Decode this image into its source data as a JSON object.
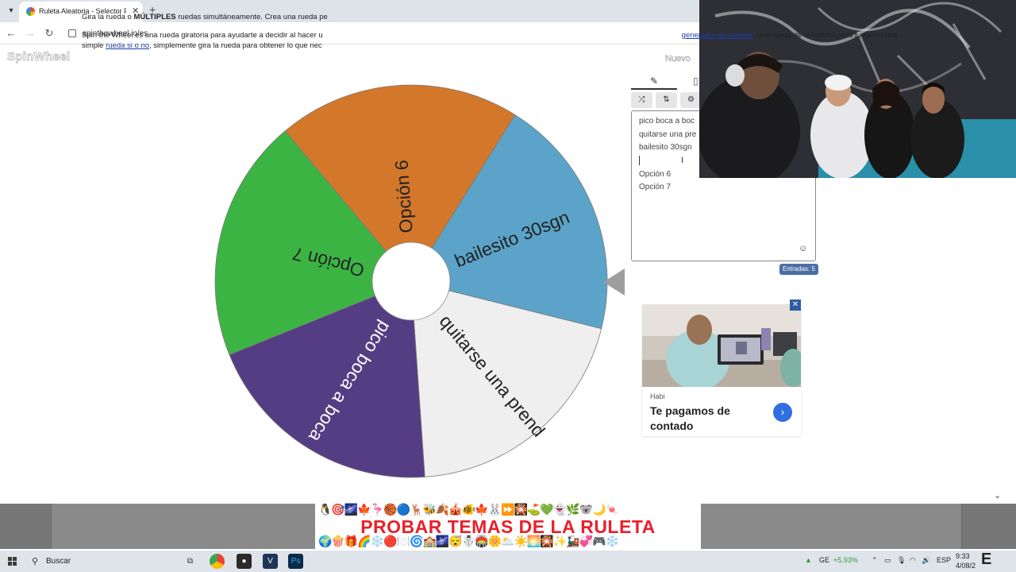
{
  "browser": {
    "tab_title": "Ruleta Aleatoria - Selector Perso",
    "url": "spinthewheel.io/es"
  },
  "page": {
    "logo": "SpinWheel",
    "new_button": "Nuevo"
  },
  "wheel": {
    "segments": [
      {
        "label": "bailesito 30sgn",
        "color": "#5ba3c8"
      },
      {
        "label": "quitarse una prend",
        "color": "#efefef"
      },
      {
        "label": "pico boca a boca",
        "color": "#553d84"
      },
      {
        "label": "Opción 7",
        "color": "#3cb444"
      },
      {
        "label": "Opción 6",
        "color": "#d3772b"
      }
    ],
    "text_colors": [
      "#222222",
      "#222222",
      "#ffffff",
      "#222222",
      "#222222"
    ],
    "hub_color": "#ffffff"
  },
  "editor": {
    "entries": [
      "pico boca a boc",
      "quitarse una pre",
      "bailesito 30sgn",
      "",
      "Opción 6",
      "Opción 7"
    ],
    "entries_count": "Entradas: 5"
  },
  "ad": {
    "sponsor": "Habi",
    "headline": "Te pagamos de contado"
  },
  "description": {
    "line1_a": "Gira la rueda o ",
    "line1_bold": "MÚLTIPLES",
    "line1_b": " ruedas simultáneamente. Crea una rueda pe",
    "line2_a": "Spin the Wheel es una rueda giratoria para ayudarte a decidir al hacer u",
    "line2_link1": "generador de sorteos",
    "line2_b": ", una rueda de la fortuna para juegos o una",
    "line3_a": "simple ",
    "line3_link2": "rueda si o no",
    "line3_b": ", simplemente gira la rueda para obtener lo que nec"
  },
  "banner": {
    "title": "PROBAR TEMAS DE LA RULETA",
    "emojis_top": "🐧🎯🌌🍁🦩🏀🔵🦌🐝🍂🎪🐠🍁🐰⏩🎇⛳💚👻🌿🐨🌙🍬",
    "emojis_bottom": "🌍🍿🎁🌈❄️🔴🍽️🌀🏫🌌😴☃️🏟️🌼🌥️☀️🌅🎇✨🚂💞🎮❄️"
  },
  "taskbar": {
    "search": "Buscar",
    "stock_name": "GE",
    "stock_change": "+5.93%",
    "lang": "ESP",
    "time": "9:33",
    "date": "4/08/2"
  }
}
